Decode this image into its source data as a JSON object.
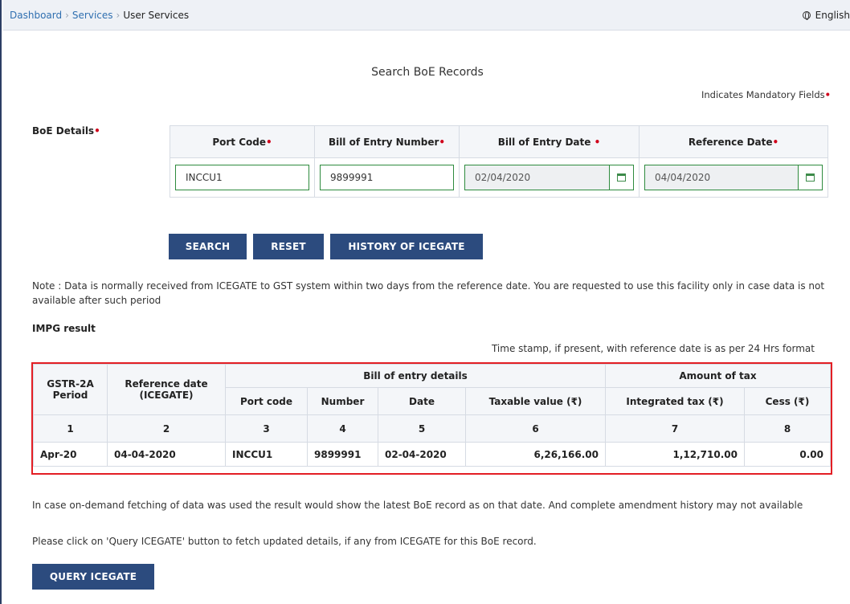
{
  "breadcrumb": {
    "dashboard": "Dashboard",
    "services": "Services",
    "current": "User Services",
    "separator": "›"
  },
  "language": "English",
  "page_title": "Search BoE Records",
  "mandatory_note": "Indicates Mandatory Fields",
  "required_mark": "•",
  "boe": {
    "label": "BoE Details",
    "columns": [
      "Port Code",
      "Bill of Entry Number",
      "Bill of Entry Date ",
      "Reference Date"
    ],
    "port_code": "INCCU1",
    "bill_number": "9899991",
    "bill_date": "02/04/2020",
    "reference_date": "04/04/2020"
  },
  "buttons": {
    "search": "SEARCH",
    "reset": "RESET",
    "history": "HISTORY OF ICEGATE",
    "query": "QUERY ICEGATE"
  },
  "note": "Note : Data is normally received from ICEGATE to GST system within two days from the reference date. You are requested to use this facility only in case data is not available after such period",
  "impg_title": "IMPG result",
  "timestamp_note": "Time stamp, if present, with reference date is as per 24 Hrs format",
  "result": {
    "headers": {
      "period": "GSTR-2A Period",
      "ref_date": "Reference date (ICEGATE)",
      "bill_details": "Bill of entry details",
      "amount_of_tax": "Amount of tax",
      "port_code": "Port code",
      "number": "Number",
      "date": "Date",
      "taxable_value": "Taxable value (₹)",
      "integrated_tax": "Integrated tax (₹)",
      "cess": "Cess (₹)"
    },
    "col_numbers": [
      "1",
      "2",
      "3",
      "4",
      "5",
      "6",
      "7",
      "8"
    ],
    "row": {
      "period": "Apr-20",
      "ref_date": "04-04-2020",
      "port_code": "INCCU1",
      "number": "9899991",
      "date": "02-04-2020",
      "taxable_value": "6,26,166.00",
      "integrated_tax": "1,12,710.00",
      "cess": "0.00"
    }
  },
  "footer_note_1": "In case on-demand fetching of data was used the result would show the latest BoE record as on that date. And complete amendment history may not available",
  "footer_note_2": "Please click on 'Query ICEGATE' button to fetch updated details, if any from ICEGATE for this BoE record.",
  "colors": {
    "button": "#2c4b7e",
    "link": "#2f6fb0",
    "required": "#d0021b",
    "highlight": "#e31e24",
    "input_border": "#2e8b3e"
  }
}
